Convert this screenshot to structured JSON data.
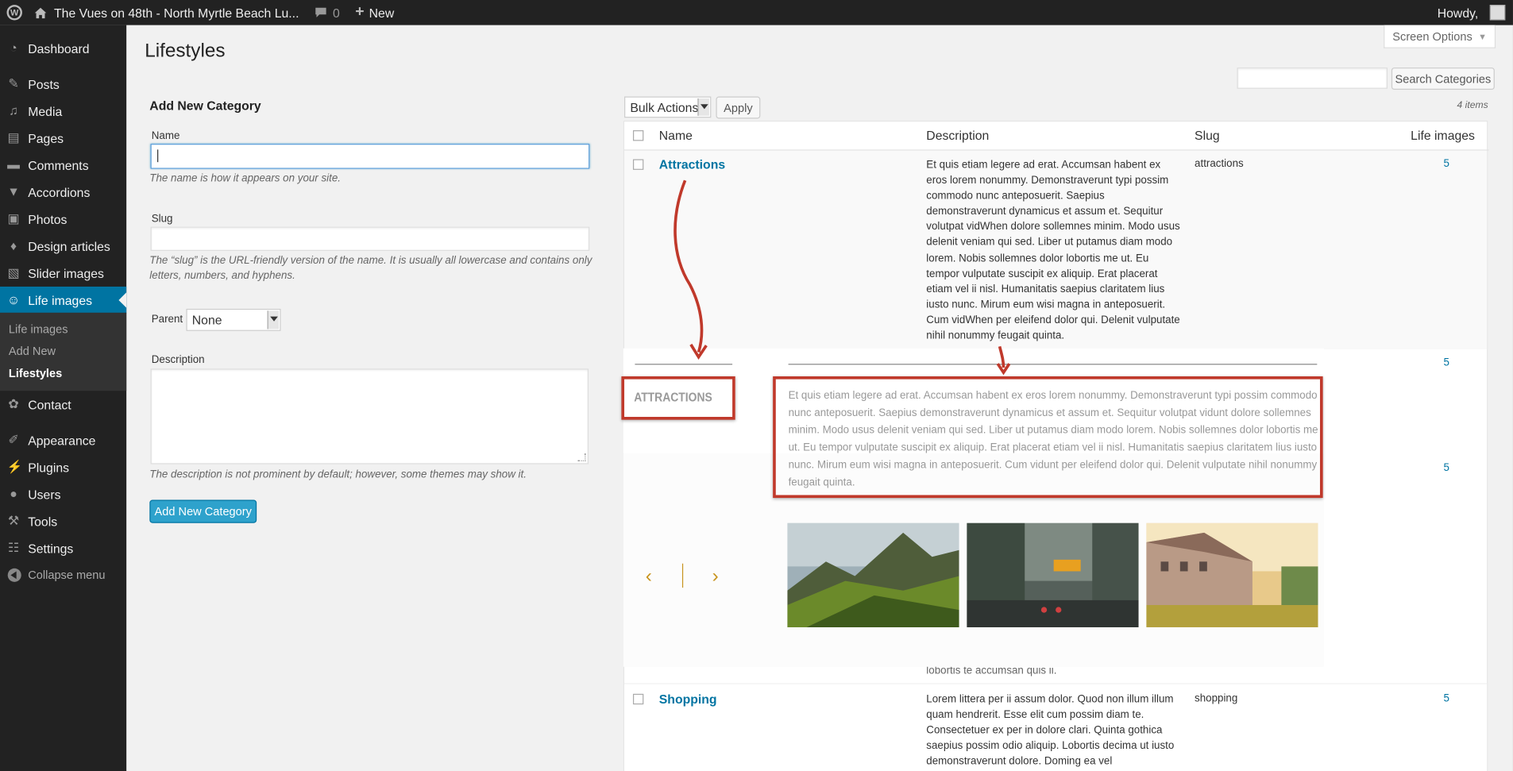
{
  "admin_bar": {
    "site_title": "The Vues on 48th - North Myrtle Beach Lu...",
    "comments_count": "0",
    "new_label": "New",
    "howdy": "Howdy,"
  },
  "sidebar": {
    "items": [
      {
        "label": "Dashboard",
        "icon": "dashboard-icon"
      },
      {
        "label": "Posts",
        "icon": "pin-icon"
      },
      {
        "label": "Media",
        "icon": "media-icon"
      },
      {
        "label": "Pages",
        "icon": "pages-icon"
      },
      {
        "label": "Comments",
        "icon": "comment-icon"
      },
      {
        "label": "Accordions",
        "icon": "accordion-icon"
      },
      {
        "label": "Photos",
        "icon": "camera-icon"
      },
      {
        "label": "Design articles",
        "icon": "drop-icon"
      },
      {
        "label": "Slider images",
        "icon": "image-icon"
      },
      {
        "label": "Life images",
        "icon": "smiley-icon"
      },
      {
        "label": "Contact",
        "icon": "gear-icon"
      },
      {
        "label": "Appearance",
        "icon": "brush-icon"
      },
      {
        "label": "Plugins",
        "icon": "plug-icon"
      },
      {
        "label": "Users",
        "icon": "user-icon"
      },
      {
        "label": "Tools",
        "icon": "wrench-icon"
      },
      {
        "label": "Settings",
        "icon": "settings-icon"
      }
    ],
    "submenu": [
      "Life images",
      "Add New",
      "Lifestyles"
    ],
    "collapse_label": "Collapse menu"
  },
  "page": {
    "title": "Lifestyles",
    "screen_options": "Screen Options"
  },
  "form": {
    "title": "Add New Category",
    "name_label": "Name",
    "name_value": "",
    "name_help": "The name is how it appears on your site.",
    "slug_label": "Slug",
    "slug_value": "",
    "slug_help": "The “slug” is the URL-friendly version of the name. It is usually all lowercase and contains only letters, numbers, and hyphens.",
    "parent_label": "Parent",
    "parent_value": "None",
    "description_label": "Description",
    "description_value": "",
    "description_help": "The description is not prominent by default; however, some themes may show it.",
    "submit_label": "Add New Category"
  },
  "list": {
    "search_button": "Search Categories",
    "search_value": "",
    "bulk_actions": "Bulk Actions",
    "apply": "Apply",
    "items_count": "4 items",
    "columns": [
      "Name",
      "Description",
      "Slug",
      "Life images"
    ],
    "rows": [
      {
        "name": "Attractions",
        "description": "Et quis etiam legere ad erat. Accumsan habent ex eros lorem nonummy. Demonstraverunt typi possim commodo nunc anteposuerit. Saepius demonstraverunt dynamicus et assum et. Sequitur volutpat vidWhen dolore sollemnes minim. Modo usus delenit veniam qui sed. Liber ut putamus diam modo lorem. Nobis sollemnes dolor lobortis me ut. Eu tempor vulputate suscipit ex aliquip. Erat placerat etiam vel ii nisl. Humanitatis saepius claritatem lius iusto nunc. Mirum eum wisi magna in anteposuerit. Cum vidWhen per eleifend dolor qui. Delenit vulputate nihil nonummy feugait quinta.",
        "slug": "attractions",
        "count": "5"
      },
      {
        "name": "",
        "description": "",
        "slug": "",
        "count": "5"
      },
      {
        "name": "",
        "description": "lobortis te accumsan quis ii.",
        "slug": "",
        "count": "5"
      },
      {
        "name": "Shopping",
        "description": "Lorem littera per ii assum dolor. Quod non illum illum quam hendrerit. Esse elit cum possim diam te. Consectetuer ex per in dolore clari. Quinta gothica saepius possim odio aliquip. Lobortis decima ut iusto demonstraverunt dolore. Doming ea vel",
        "slug": "shopping",
        "count": "5"
      }
    ]
  },
  "preview": {
    "heading": "ATTRACTIONS",
    "description": "Et quis etiam legere ad erat. Accumsan habent ex eros lorem nonummy. Demonstraverunt typi possim commodo nunc anteposuerit. Saepius demonstraverunt dynamicus et assum et. Sequitur volutpat vidunt dolore sollemnes minim. Modo usus delenit veniam qui sed. Liber ut putamus diam modo lorem. Nobis sollemnes dolor lobortis me ut. Eu tempor vulputate suscipit ex aliquip. Erat placerat etiam vel ii nisl. Humanitatis saepius claritatem lius iusto nunc. Mirum eum wisi magna in anteposuerit. Cum vidunt per eleifend dolor qui. Delenit vulputate nihil nonummy feugait quinta.",
    "prev_arrow": "‹",
    "next_arrow": "›"
  },
  "colors": {
    "accent": "#0074a2",
    "annotation_red": "#c0392b",
    "slider_gold": "#c8941e"
  }
}
